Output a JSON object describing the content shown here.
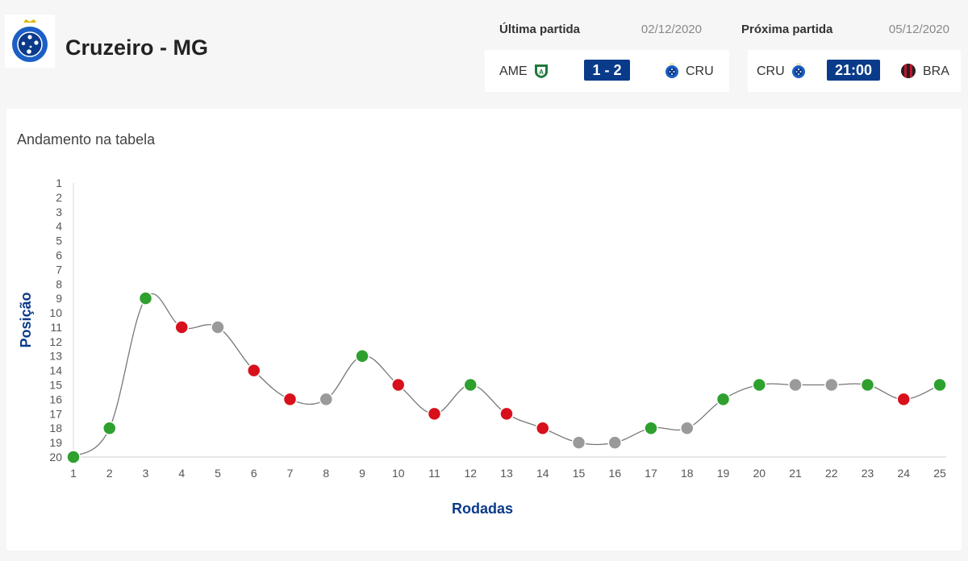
{
  "team": {
    "name": "Cruzeiro - MG",
    "colors": {
      "primary": "#0a3a8a",
      "crest": "#1b5fc4"
    }
  },
  "last_match": {
    "label": "Última partida",
    "date": "02/12/2020",
    "home": "AME",
    "away": "CRU",
    "score": "1 - 2",
    "home_icon": "america-mg-crest-icon",
    "away_icon": "cruzeiro-crest-icon"
  },
  "next_match": {
    "label": "Próxima partida",
    "date": "05/12/2020",
    "home": "CRU",
    "away": "BRA",
    "time": "21:00",
    "home_icon": "cruzeiro-crest-icon",
    "away_icon": "athletico-pr-crest-icon"
  },
  "chart_data": {
    "type": "line",
    "title": "Andamento na tabela",
    "xlabel": "Rodadas",
    "ylabel": "Posição",
    "x": [
      1,
      2,
      3,
      4,
      5,
      6,
      7,
      8,
      9,
      10,
      11,
      12,
      13,
      14,
      15,
      16,
      17,
      18,
      19,
      20,
      21,
      22,
      23,
      24,
      25
    ],
    "y": [
      20,
      18,
      9,
      11,
      11,
      14,
      16,
      16,
      13,
      15,
      17,
      15,
      17,
      18,
      19,
      19,
      18,
      18,
      16,
      15,
      15,
      15,
      15,
      16,
      15
    ],
    "results": [
      "V",
      "V",
      "V",
      "D",
      "E",
      "D",
      "D",
      "E",
      "V",
      "D",
      "D",
      "V",
      "D",
      "D",
      "E",
      "E",
      "V",
      "E",
      "V",
      "V",
      "E",
      "E",
      "V",
      "D",
      "V"
    ],
    "ylim": [
      1,
      20
    ],
    "y_inverted": true,
    "y_ticks": [
      1,
      2,
      3,
      4,
      5,
      6,
      7,
      8,
      9,
      10,
      11,
      12,
      13,
      14,
      15,
      16,
      17,
      18,
      19,
      20
    ],
    "result_colors": {
      "V": "#2ea02e",
      "E": "#9a9a9a",
      "D": "#d8101c"
    },
    "line_color": "#777777",
    "grid": false
  }
}
